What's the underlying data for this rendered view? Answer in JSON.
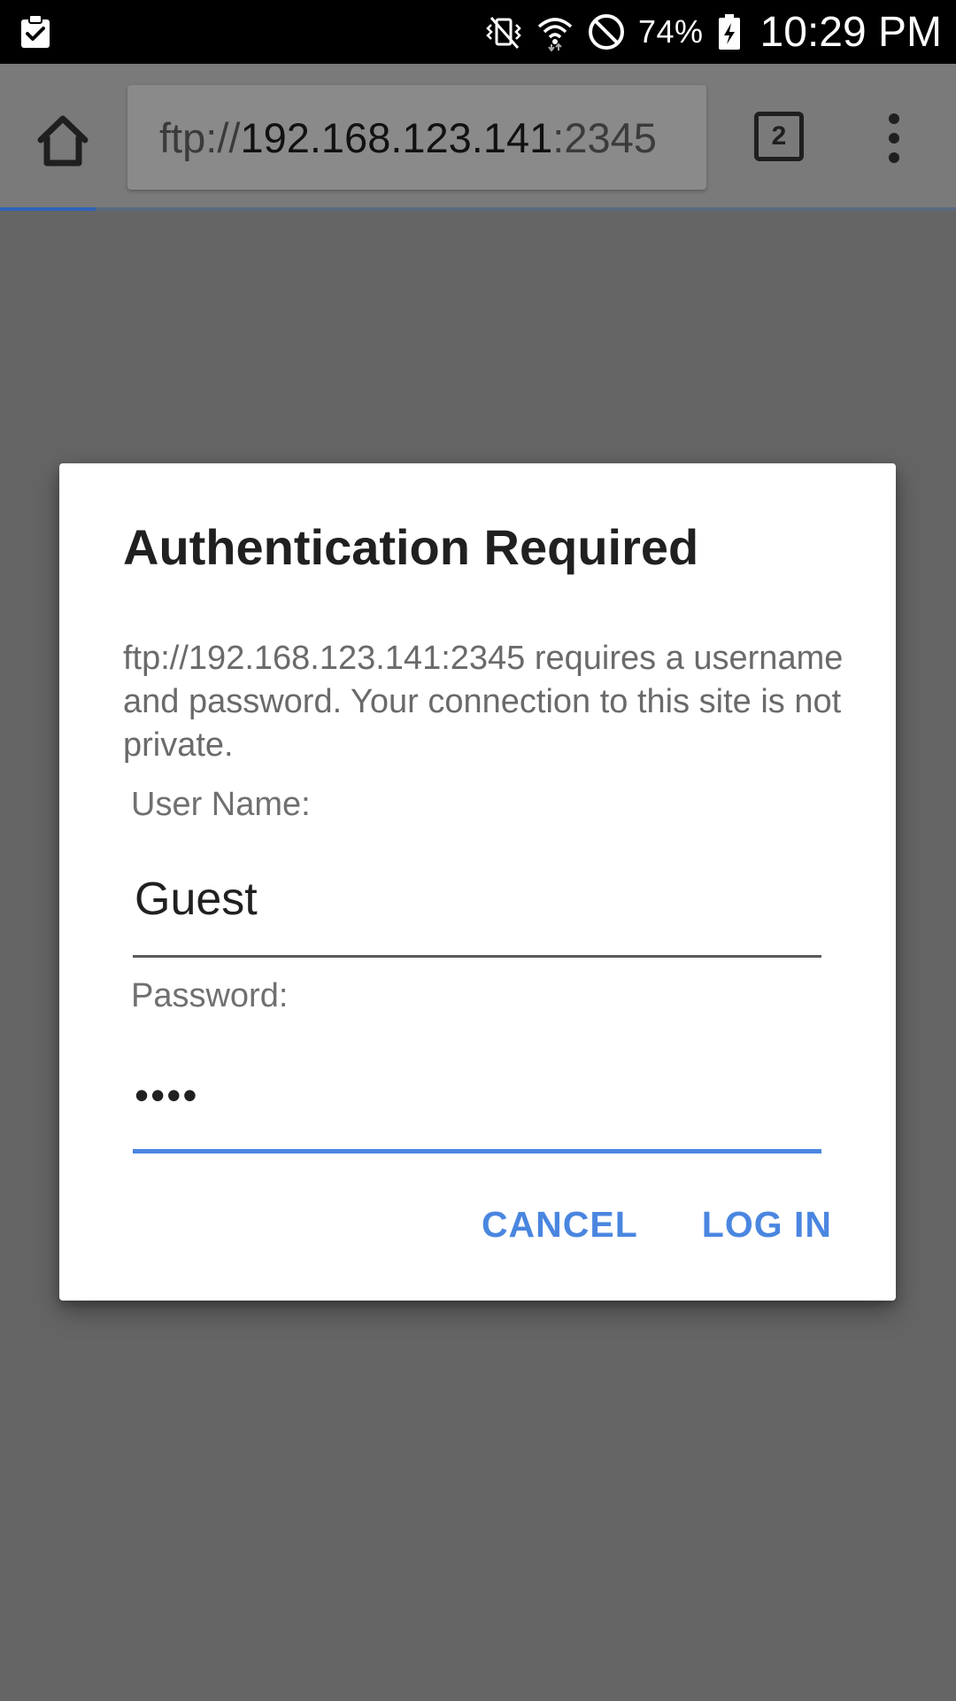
{
  "status_bar": {
    "left_icon": "clipboard-check-icon",
    "icons": [
      "vibrate-mute-icon",
      "wifi-icon",
      "do-not-disturb-icon"
    ],
    "battery_percent": "74%",
    "battery_icon": "battery-charging-icon",
    "time": "10:29 PM"
  },
  "toolbar": {
    "home_icon": "home-icon",
    "url": {
      "scheme": "ftp://",
      "host": "192.168.123.141",
      "port": ":2345"
    },
    "tab_count": "2",
    "menu_icon": "more-vert-icon",
    "load_progress": 0.1
  },
  "dialog": {
    "title": "Authentication Required",
    "message": "ftp://192.168.123.141:2345 requires a username and password. Your connection to this site is not private.",
    "username_label": "User Name:",
    "username_value": "Guest",
    "password_label": "Password:",
    "password_value": "••••",
    "cancel_label": "CANCEL",
    "login_label": "LOG IN",
    "accent_color": "#4a86e0"
  },
  "colors": {
    "scrim": "#656565",
    "accent": "#4a86e0",
    "progress": "#2f63b8"
  }
}
